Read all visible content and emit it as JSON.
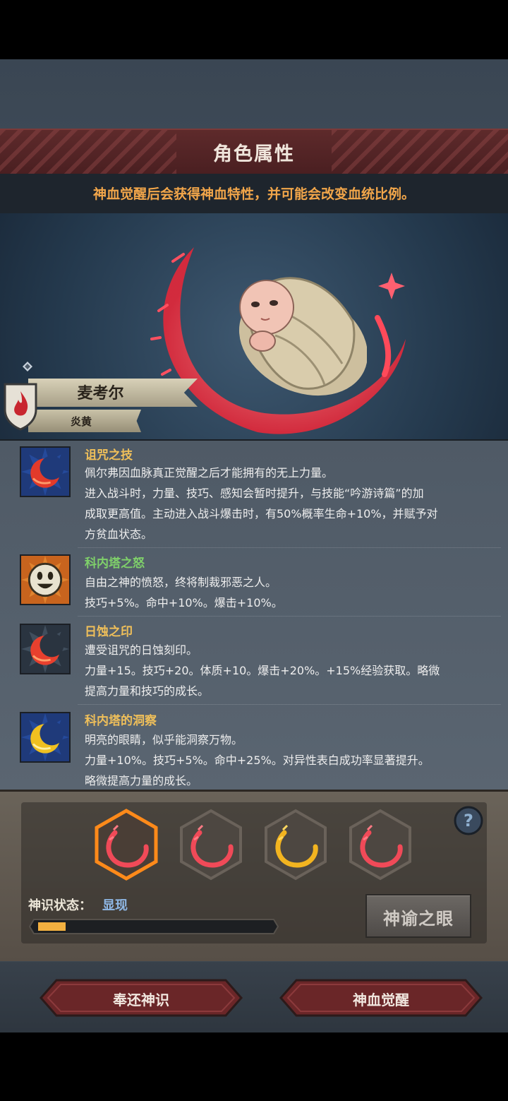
{
  "header": {
    "title": "角色属性",
    "hint": "神血觉醒后会获得神血特性，并可能会改变血统比例。"
  },
  "character": {
    "name": "麦考尔",
    "bloodline": "炎黄",
    "shield_icon": "flame-shield-icon"
  },
  "traits": [
    {
      "title": "诅咒之技",
      "title_color": "#efbf5a",
      "icon": "red-crescent-icon",
      "lines": [
        "佩尔弗因血脉真正觉醒之后才能拥有的无上力量。",
        "进入战斗时，力量、技巧、感知会暂时提升，与技能“吟游诗篇”的加",
        "成取更高值。主动进入战斗爆击时，有50%概率生命+10%，并赋予对",
        "方贫血状态。"
      ]
    },
    {
      "title": "科内塔之怒",
      "title_color": "#7fd06a",
      "icon": "smiley-face-icon",
      "lines": [
        "自由之神的愤怒，终将制裁邪恶之人。",
        "技巧+5%。命中+10%。爆击+10%。"
      ]
    },
    {
      "title": "日蚀之印",
      "title_color": "#efbf5a",
      "icon": "red-crescent-icon",
      "lines": [
        "遭受诅咒的日蚀刻印。",
        "力量+15。技巧+20。体质+10。爆击+20%。+15%经验获取。略微",
        "提高力量和技巧的成长。"
      ]
    },
    {
      "title": "科内塔的洞察",
      "title_color": "#efbf5a",
      "icon": "gold-crescent-icon",
      "lines": [
        "明亮的眼睛，似乎能洞察万物。",
        "力量+10%。技巧+5%。命中+25%。对异性表白成功率显著提升。",
        "略微提高力量的成长。"
      ]
    }
  ],
  "awakening": {
    "slots": [
      {
        "icon": "red-crescent-icon",
        "selected": true
      },
      {
        "icon": "red-crescent-icon",
        "selected": false
      },
      {
        "icon": "gold-crescent-icon",
        "selected": false
      },
      {
        "icon": "red-crescent-icon",
        "selected": false
      }
    ],
    "status_label": "神识状态：",
    "status_value": "显现",
    "progress_fraction": 0.12,
    "oracle_button": "神谕之眼",
    "help_icon": "question-mark-icon"
  },
  "buttons": {
    "return": "奉还神识",
    "awaken": "神血觉醒"
  },
  "colors": {
    "accent_orange": "#f2a64a",
    "title_red": "#5e2a2b",
    "status_blue": "#8fb8e6"
  }
}
